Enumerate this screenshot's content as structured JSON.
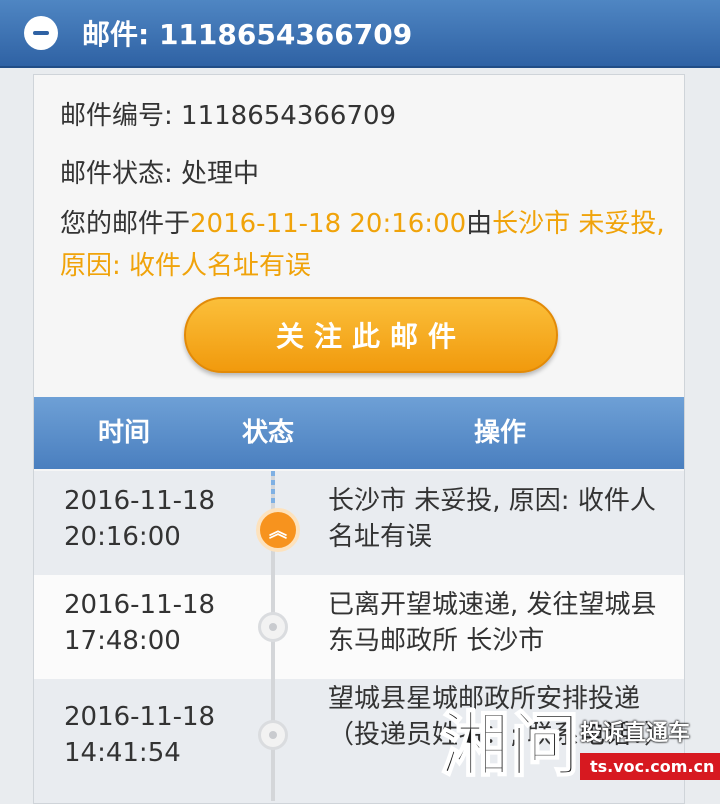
{
  "header": {
    "title": "邮件: 1118654366709",
    "collapse_icon": "minus-circle-icon"
  },
  "info": {
    "number_label": "邮件编号:",
    "number_value": "1118654366709",
    "status_label": "邮件状态:",
    "status_value": "处理中",
    "desc_prefix": "您的邮件于",
    "desc_time": "2016-11-18 20:16:00",
    "desc_mid": "由",
    "desc_detail": "长沙市 未妥投, 原因: 收件人名址有误"
  },
  "follow_button": {
    "label": "关注此邮件"
  },
  "table": {
    "headers": {
      "time": "时间",
      "status": "状态",
      "action": "操作"
    },
    "rows": [
      {
        "date": "2016-11-18",
        "time": "20:16:00",
        "action": "长沙市 未妥投, 原因: 收件人名址有误",
        "status_icon": "double-chevron-up-icon"
      },
      {
        "date": "2016-11-18",
        "time": "17:48:00",
        "action": "已离开望城速递, 发往望城县东马邮政所 长沙市",
        "status_icon": "dot-icon"
      },
      {
        "date": "2016-11-18",
        "time": "14:41:54",
        "action": "望城县星城邮政所安排投递（投递员姓名：; 联系电话：）",
        "status_icon": "dot-icon"
      }
    ]
  },
  "watermark": {
    "logo": "湘问",
    "slogan": "投诉直通车",
    "site": "ts.voc.com.cn"
  },
  "colors": {
    "header_blue": "#2f62a4",
    "accent_orange": "#f0a30a",
    "table_head_blue": "#5a8dc8"
  }
}
